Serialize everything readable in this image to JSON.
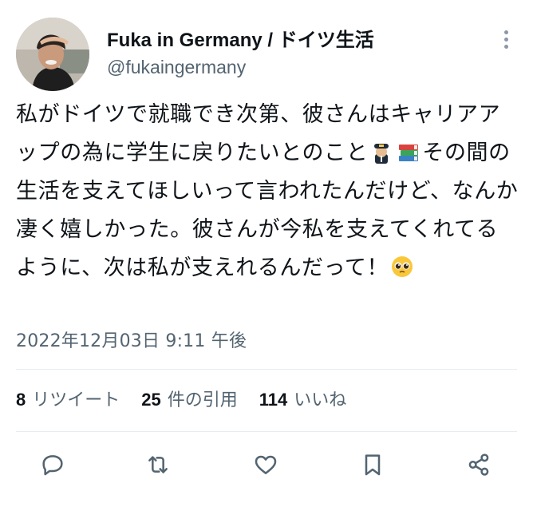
{
  "author": {
    "display_name": "Fuka in Germany / ドイツ生活",
    "handle": "@fukaingermany",
    "avatar_icon": "profile-photo"
  },
  "tweet": {
    "text_part1": "私がドイツで就職でき次第、彼さんはキャリアアップの為に学生に戻りたいとのこと",
    "emoji1": "pilot-emoji",
    "emoji2": "books-emoji",
    "text_part2": "その間の生活を支えてほしいって言われたんだけど、なんか凄く嬉しかった。彼さんが今私を支えてくれてるように、次は私が支えれるんだって！",
    "emoji3": "pleading-face-emoji",
    "timestamp": "2022年12月03日 9:11 午後"
  },
  "stats": {
    "retweets_count": "8",
    "retweets_label": "リツイート",
    "quotes_count": "25",
    "quotes_label": "件の引用",
    "likes_count": "114",
    "likes_label": "いいね"
  },
  "actions": {
    "reply_icon": "reply-icon",
    "retweet_icon": "retweet-icon",
    "like_icon": "heart-icon",
    "bookmark_icon": "bookmark-icon",
    "share_icon": "share-icon"
  },
  "colors": {
    "text_primary": "#0f1419",
    "text_secondary": "#536471",
    "divider": "#e6ecf0",
    "icon": "#536471"
  }
}
